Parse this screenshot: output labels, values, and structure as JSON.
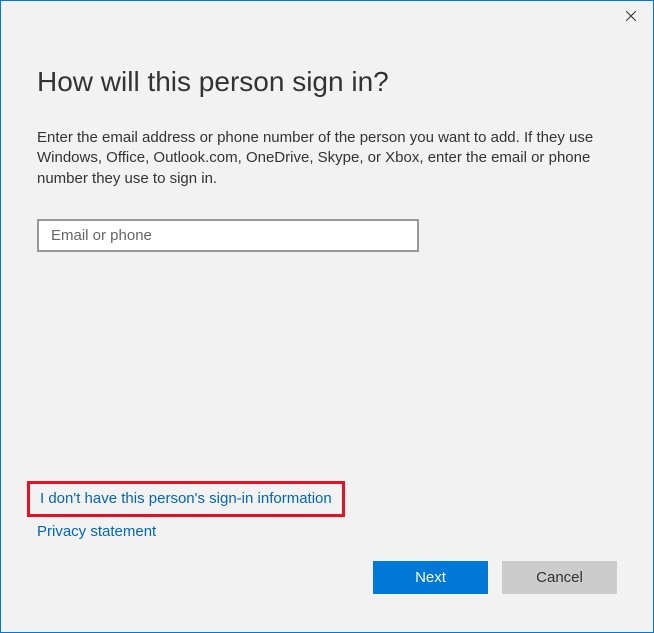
{
  "dialog": {
    "title": "How will this person sign in?",
    "description": "Enter the email address or phone number of the person you want to add. If they use Windows, Office, Outlook.com, OneDrive, Skype, or Xbox, enter the email or phone number they use to sign in.",
    "input_placeholder": "Email or phone",
    "input_value": "",
    "link_no_info": "I don't have this person's sign-in information",
    "link_privacy": "Privacy statement",
    "btn_next": "Next",
    "btn_cancel": "Cancel"
  }
}
